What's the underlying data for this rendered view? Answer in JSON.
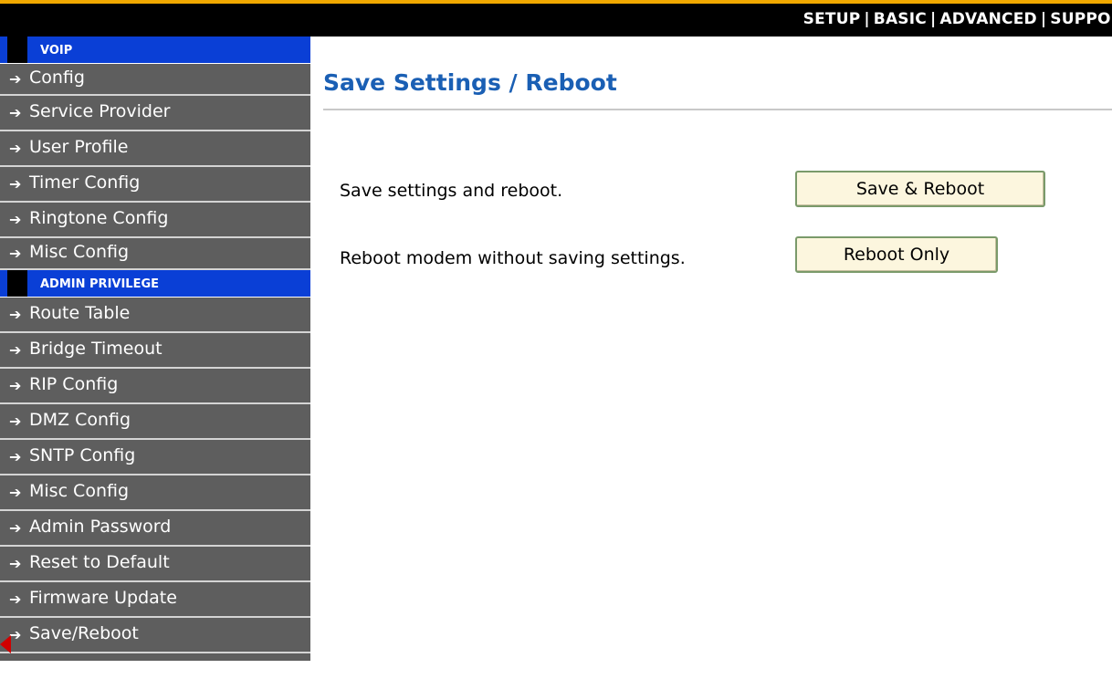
{
  "topnav": {
    "items": [
      "SETUP",
      "BASIC",
      "ADVANCED",
      "SUPPOR"
    ],
    "separator": "|"
  },
  "sidebar": {
    "sections": [
      {
        "header": "VOIP",
        "items": [
          "Config",
          "Service Provider",
          "User Profile",
          "Timer Config",
          "Ringtone Config",
          "Misc Config"
        ]
      },
      {
        "header": "ADMIN PRIVILEGE",
        "items": [
          "Route Table",
          "Bridge Timeout",
          "RIP Config",
          "DMZ Config",
          "SNTP Config",
          "Misc Config",
          "Admin Password",
          "Reset to Default",
          "Firmware Update",
          "Save/Reboot"
        ]
      }
    ],
    "arrow_glyph": "➔"
  },
  "main": {
    "title": "Save Settings / Reboot",
    "rows": [
      {
        "label": "Save settings and reboot.",
        "button": "Save & Reboot"
      },
      {
        "label": "Reboot modem without saving settings.",
        "button": "Reboot Only"
      }
    ]
  },
  "colors": {
    "section_header": "#0a3fd6",
    "nav_item_bg": "#5e5e5e",
    "title": "#1a5fb4",
    "button_bg": "#fcf6de",
    "accent_stripe": "#f0a800"
  }
}
